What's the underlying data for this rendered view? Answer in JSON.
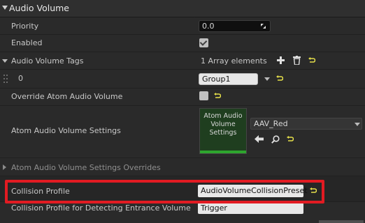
{
  "section": {
    "title": "Audio Volume"
  },
  "rows": {
    "priority": {
      "label": "Priority",
      "value": "0.0"
    },
    "enabled": {
      "label": "Enabled"
    },
    "tags": {
      "label": "Audio Volume Tags",
      "summary": "1 Array elements"
    },
    "tag0": {
      "index": "0",
      "value": "Group1"
    },
    "override": {
      "label": "Override Atom Audio Volume"
    },
    "settings": {
      "label": "Atom Audio Volume Settings",
      "thumb_line1": "Atom Audio",
      "thumb_line2": "Volume",
      "thumb_line3": "Settings",
      "asset": "AAV_Red"
    },
    "overrides": {
      "label": "Atom Audio Volume Settings Overrides"
    },
    "collision": {
      "label": "Collision Profile",
      "value": "AudioVolumeCollisionPreset"
    },
    "collision_entrance": {
      "label": "Collision Profile for Detecting Entrance Volume",
      "value": "Trigger"
    }
  },
  "colors": {
    "reset": "#e6e04a",
    "accent_green": "#2ea52e",
    "highlight": "#e21b22"
  },
  "icons": [
    "chevron-down-icon",
    "drag-icon",
    "check-icon",
    "reset-arrow-icon",
    "add-icon",
    "trash-icon",
    "grip-icon",
    "browse-arrow-icon",
    "search-icon"
  ]
}
